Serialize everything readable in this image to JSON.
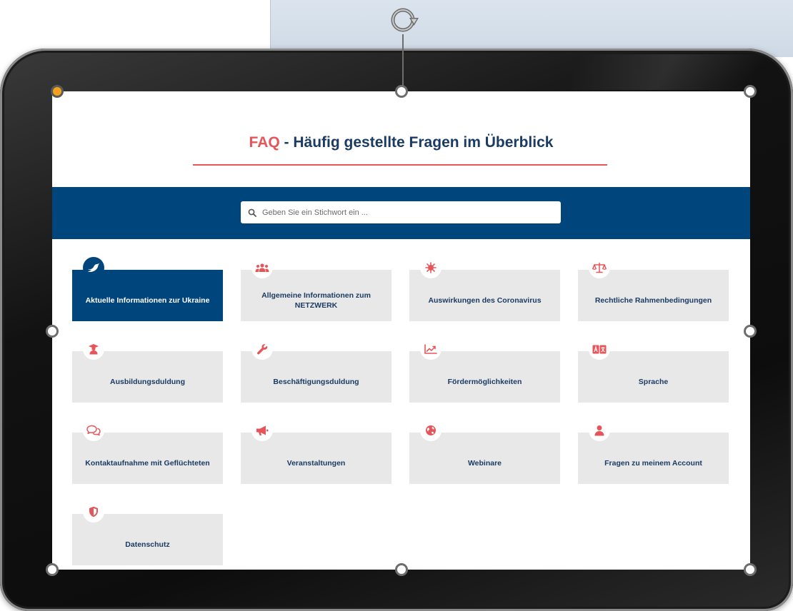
{
  "page": {
    "title_accent": "FAQ",
    "title_rest": " - Häufig gestellte Fragen im Überblick"
  },
  "search": {
    "placeholder": "Geben Sie ein Stichwort ein ..."
  },
  "categories": [
    {
      "label": "Aktuelle Informationen zur Ukraine",
      "icon": "bird-icon",
      "active": true
    },
    {
      "label": "Allgemeine Informationen zum NETZWERK",
      "icon": "group-icon",
      "active": false
    },
    {
      "label": "Auswirkungen des Coronavirus",
      "icon": "virus-icon",
      "active": false
    },
    {
      "label": "Rechtliche Rahmenbedingungen",
      "icon": "scales-icon",
      "active": false
    },
    {
      "label": "Ausbildungsduldung",
      "icon": "graduate-icon",
      "active": false
    },
    {
      "label": "Beschäftigungsduldung",
      "icon": "wrench-icon",
      "active": false
    },
    {
      "label": "Fördermöglichkeiten",
      "icon": "chart-icon",
      "active": false
    },
    {
      "label": "Sprache",
      "icon": "language-icon",
      "active": false
    },
    {
      "label": "Kontaktaufnahme mit Geflüchteten",
      "icon": "chat-icon",
      "active": false
    },
    {
      "label": "Veranstaltungen",
      "icon": "megaphone-icon",
      "active": false
    },
    {
      "label": "Webinare",
      "icon": "globe-icon",
      "active": false
    },
    {
      "label": "Fragen zu meinem Account",
      "icon": "user-icon",
      "active": false
    },
    {
      "label": "Datenschutz",
      "icon": "shield-icon",
      "active": false
    }
  ],
  "colors": {
    "accent": "#e5565a",
    "navy": "#00457c",
    "text": "#1b3b63",
    "card": "#e8e8e8"
  }
}
